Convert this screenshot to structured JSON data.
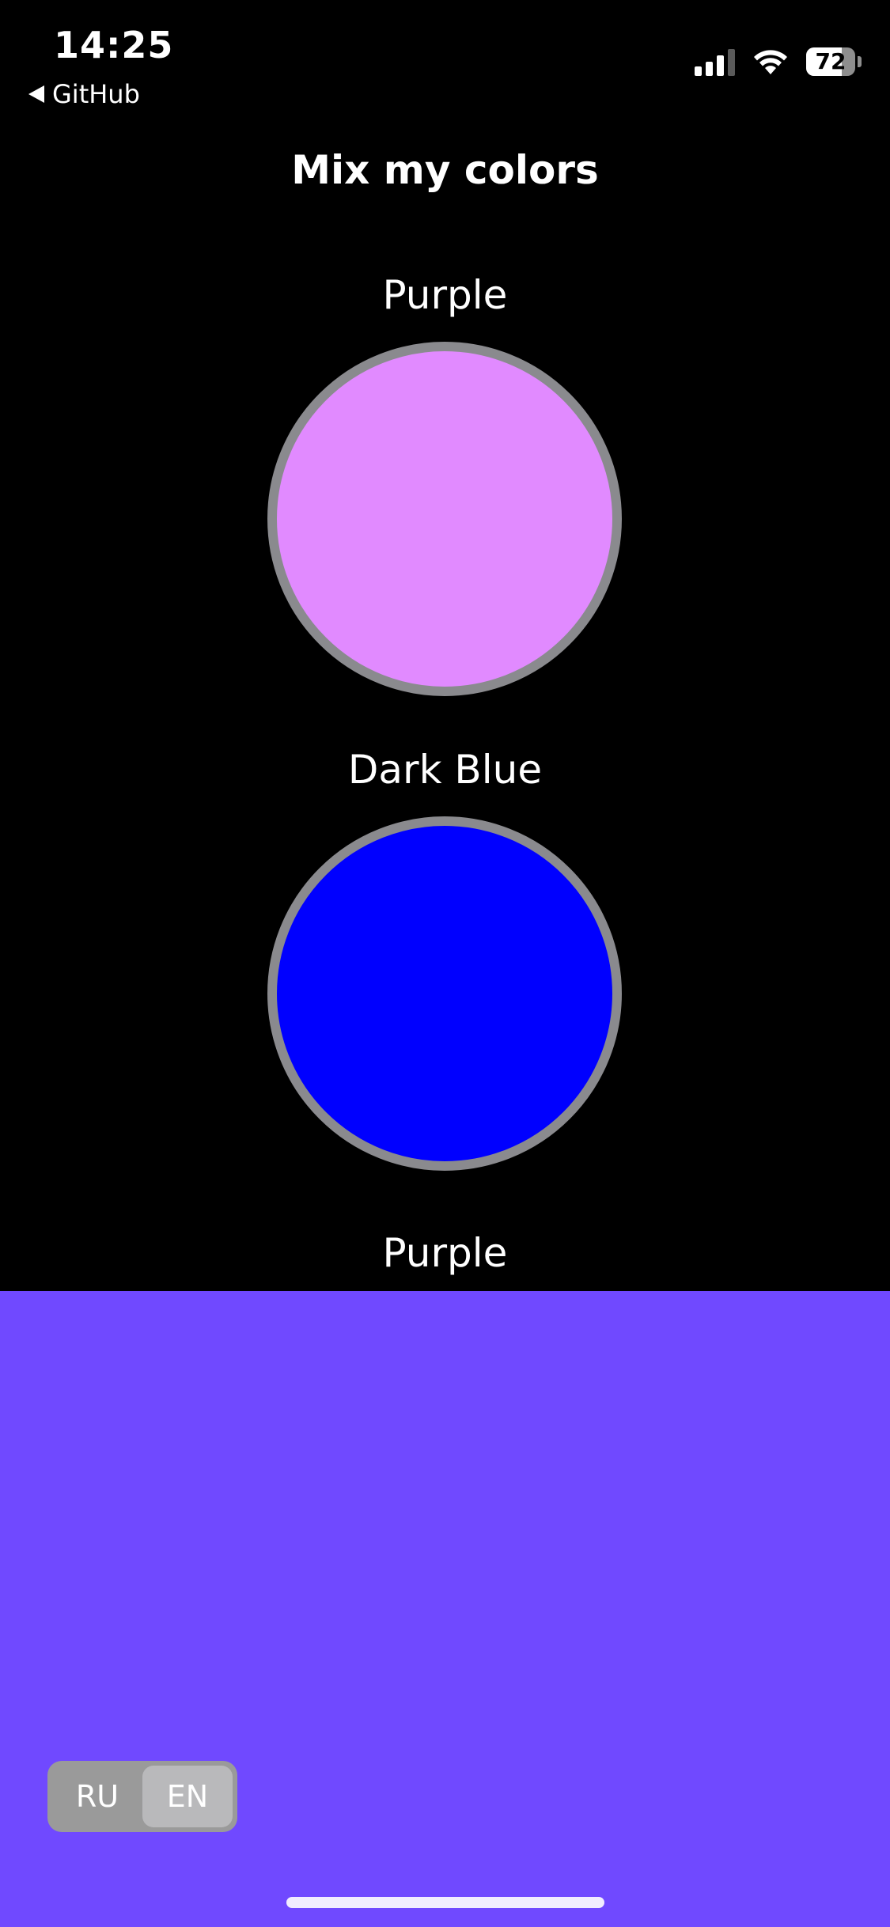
{
  "status_bar": {
    "time": "14:25",
    "back_app": "GitHub",
    "battery_percent": "72",
    "battery_level": 0.72
  },
  "title": "Mix my colors",
  "color_one": {
    "label": "Purple",
    "hex": "#e18aff"
  },
  "color_two": {
    "label": "Dark Blue",
    "hex": "#0000ff"
  },
  "result": {
    "label": "Purple",
    "hex": "#7049ff"
  },
  "language_switch": {
    "options": [
      "RU",
      "EN"
    ],
    "selected": "EN"
  },
  "colors": {
    "background": "#000000",
    "circle_border": "#8a8a8e"
  }
}
